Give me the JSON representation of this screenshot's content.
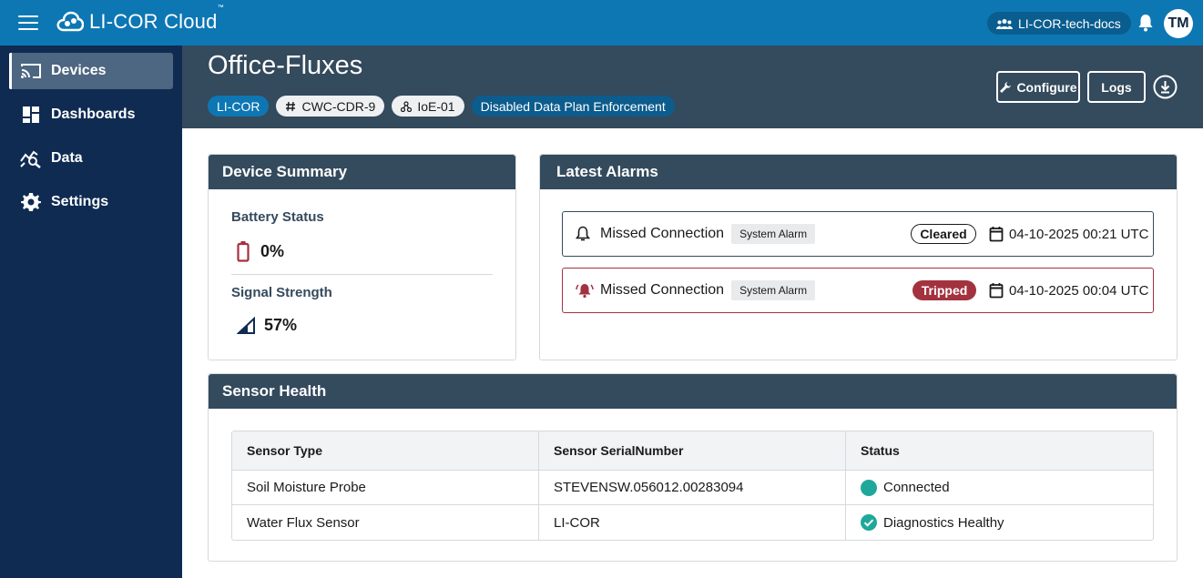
{
  "app": {
    "name": "LI-COR Cloud",
    "trademark": "™"
  },
  "topbar": {
    "org": "LI-COR-tech-docs",
    "avatar_initials": "TM"
  },
  "sidebar": {
    "items": [
      {
        "label": "Devices",
        "icon": "cast-icon",
        "active": true
      },
      {
        "label": "Dashboards",
        "icon": "dashboard-icon",
        "active": false
      },
      {
        "label": "Data",
        "icon": "data-analytics-icon",
        "active": false
      },
      {
        "label": "Settings",
        "icon": "gear-icon",
        "active": false
      }
    ]
  },
  "header": {
    "title": "Office-Fluxes",
    "tags": [
      {
        "label": "LI-COR",
        "style": "blue"
      },
      {
        "label": "CWC-CDR-9",
        "style": "light",
        "icon": "hash-icon"
      },
      {
        "label": "IoE-01",
        "style": "light",
        "icon": "network-icon"
      },
      {
        "label": "Disabled Data Plan Enforcement",
        "style": "dark"
      }
    ],
    "configure_label": "Configure",
    "logs_label": "Logs"
  },
  "device_summary": {
    "title": "Device Summary",
    "battery_label": "Battery Status",
    "battery_value": "0%",
    "signal_label": "Signal Strength",
    "signal_value": "57%"
  },
  "alarms": {
    "title": "Latest Alarms",
    "items": [
      {
        "title": "Missed Connection",
        "type": "System Alarm",
        "status": "Cleared",
        "date": "04-10-2025 00:21 UTC"
      },
      {
        "title": "Missed Connection",
        "type": "System Alarm",
        "status": "Tripped",
        "date": "04-10-2025 00:04 UTC"
      }
    ]
  },
  "sensor_health": {
    "title": "Sensor Health",
    "columns": [
      "Sensor Type",
      "Sensor SerialNumber",
      "Status"
    ],
    "rows": [
      {
        "type": "Soil Moisture Probe",
        "serial": "STEVENSW.056012.00283094",
        "status": "Connected"
      },
      {
        "type": "Water Flux Sensor",
        "serial": "LI-COR",
        "status": "Diagnostics Healthy"
      }
    ]
  },
  "colors": {
    "topbar": "#0d77b4",
    "sidebar": "#0f2b52",
    "header": "#344a5d",
    "tripped": "#a3323f",
    "connected": "#1fa89a"
  }
}
